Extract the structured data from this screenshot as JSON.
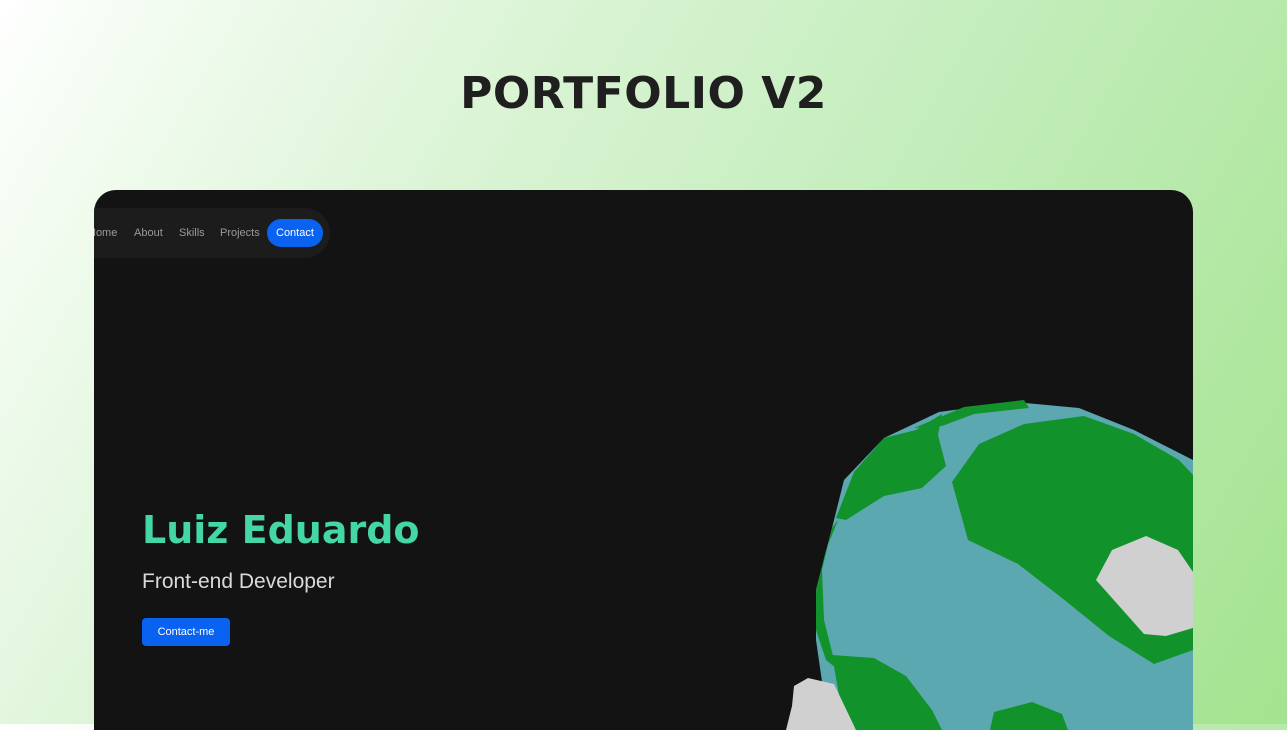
{
  "page": {
    "title": "PORTFOLIO V2"
  },
  "nav": {
    "items": [
      "Home",
      "About",
      "Skills",
      "Projects"
    ],
    "active_item": "Contact"
  },
  "hero": {
    "name": "Luiz Eduardo",
    "role": "Front-end Developer",
    "cta_label": "Contact-me"
  },
  "colors": {
    "page_gradient_light": "#ffffff",
    "page_gradient_green": "#a4e38f",
    "frame_background": "#131313",
    "nav_background": "#1c1c1c",
    "accent_blue": "#0a63f0",
    "name_teal": "#45d6a6",
    "globe_ocean": "#5ba8b0",
    "globe_land": "#12922b",
    "globe_ice": "#d0d0d0"
  },
  "illustration": {
    "icon": "low-poly-globe-icon"
  }
}
